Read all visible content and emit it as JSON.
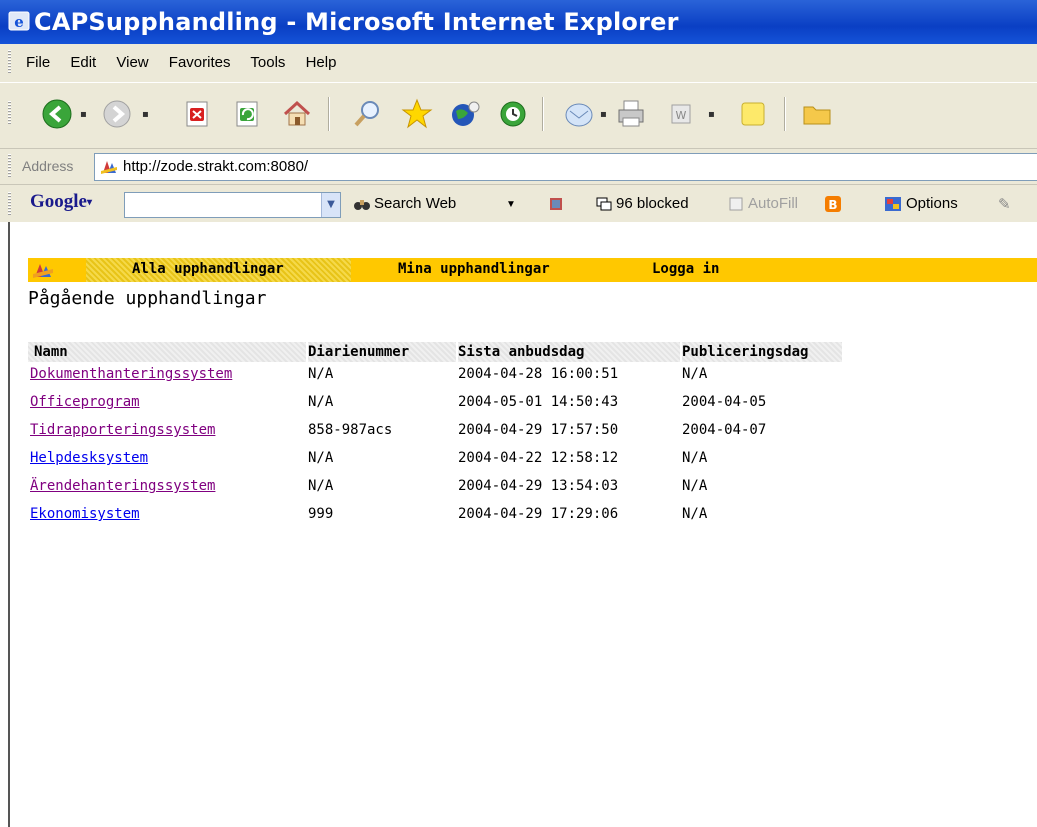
{
  "window": {
    "title": "CAPSupphandling - Microsoft Internet Explorer"
  },
  "menu": [
    "File",
    "Edit",
    "View",
    "Favorites",
    "Tools",
    "Help"
  ],
  "address": {
    "label": "Address",
    "url": "http://zode.strakt.com:8080/"
  },
  "google_toolbar": {
    "logo": "Google",
    "search_web": "Search Web",
    "blocked": "96 blocked",
    "autofill": "AutoFill",
    "options": "Options"
  },
  "site": {
    "nav": {
      "tab_all": "Alla upphandlingar",
      "tab_mine": "Mina upphandlingar",
      "login": "Logga in",
      "colors": {
        "bar": "#ffc800"
      }
    },
    "heading": "Pågående upphandlingar",
    "table": {
      "headers": [
        "Namn",
        "Diarienummer",
        "Sista anbudsdag",
        "Publiceringsdag"
      ],
      "rows": [
        {
          "name": "Dokumenthanteringssystem",
          "diarienummer": "N/A",
          "sista": "2004-04-28 16:00:51",
          "publicering": "N/A",
          "visited": true
        },
        {
          "name": "Officeprogram",
          "diarienummer": "N/A",
          "sista": "2004-05-01 14:50:43",
          "publicering": "2004-04-05",
          "visited": true
        },
        {
          "name": "Tidrapporteringssystem",
          "diarienummer": "858-987acs",
          "sista": "2004-04-29 17:57:50",
          "publicering": "2004-04-07",
          "visited": true
        },
        {
          "name": "Helpdesksystem",
          "diarienummer": "N/A",
          "sista": "2004-04-22 12:58:12",
          "publicering": "N/A",
          "visited": false
        },
        {
          "name": "Ärendehanteringssystem",
          "diarienummer": "N/A",
          "sista": "2004-04-29 13:54:03",
          "publicering": "N/A",
          "visited": true
        },
        {
          "name": "Ekonomisystem",
          "diarienummer": "999",
          "sista": "2004-04-29 17:29:06",
          "publicering": "N/A",
          "visited": false
        }
      ]
    }
  }
}
